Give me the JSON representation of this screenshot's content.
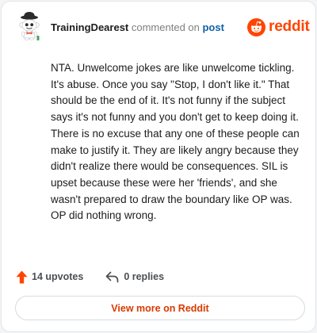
{
  "comment": {
    "author": "TrainingDearest",
    "action_text": " commented on ",
    "post_link_label": "post",
    "body": "NTA. Unwelcome jokes are like unwelcome tickling. It's abuse. Once you say \"Stop, I don't like it.\" That should be the end of it. It's not funny if the subject says it's not funny and you don't get to keep doing it. There is no excuse that any one of these people can make to justify it. They are likely angry because they didn't realize there would be consequences. SIL is upset because these were her 'friends', and she wasn't prepared to draw the boundary like OP was. OP did nothing wrong."
  },
  "brand": {
    "wordmark": "reddit",
    "logo_icon": "reddit-snoo-icon",
    "color": "#ff4500"
  },
  "footer": {
    "upvotes_label": "14 upvotes",
    "upvote_icon": "upvote-arrow-icon",
    "upvote_color": "#ff4500",
    "replies_label": "0 replies",
    "reply_icon": "reply-arrow-icon"
  },
  "view_more": {
    "label": "View more on Reddit",
    "color": "#d93a00"
  },
  "colors": {
    "link": "#0f61a8",
    "text": "#1c1c1c",
    "muted": "#7c7f82"
  }
}
